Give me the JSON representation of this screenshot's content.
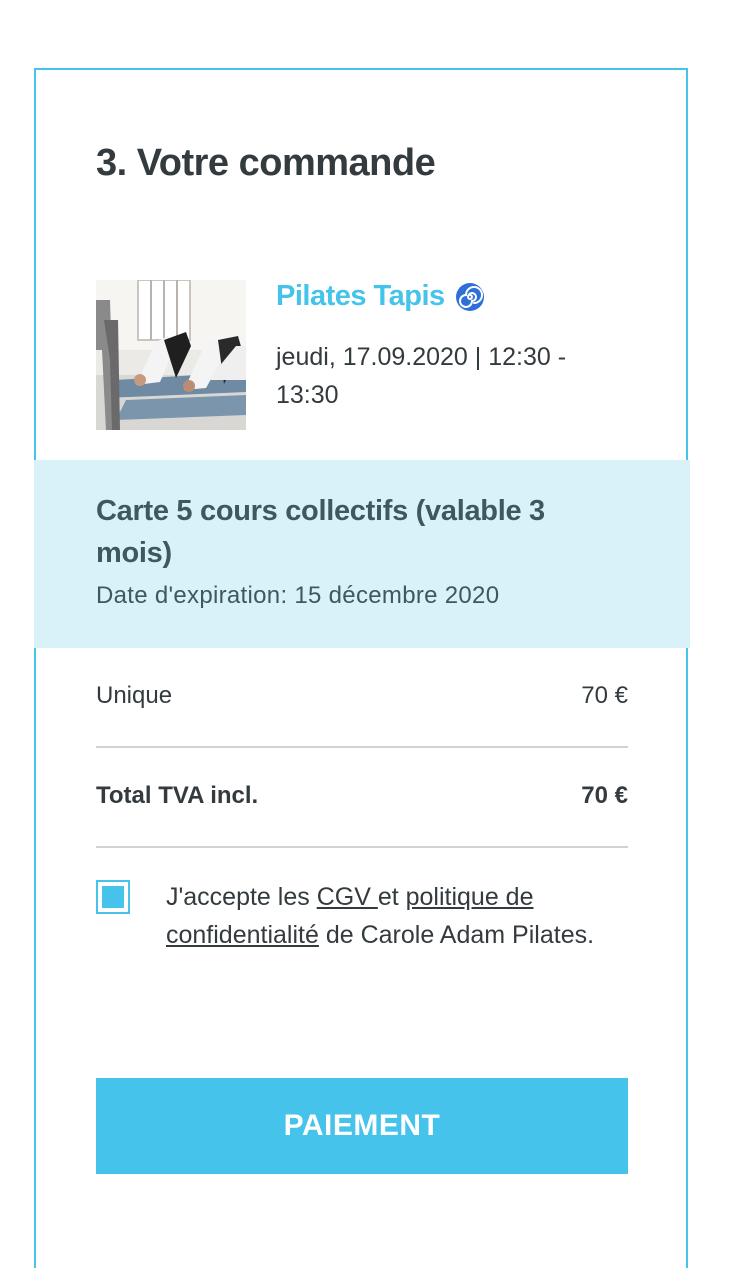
{
  "order": {
    "title": "3. Votre commande",
    "course": {
      "name": "Pilates Tapis",
      "icon": "spiral-icon",
      "date_line": "jeudi, 17.09.2020 | 12:30 - 13:30"
    },
    "plan": {
      "name": "Carte 5 cours collectifs (valable 3 mois)",
      "expiry": "Date d'expiration: 15 décembre 2020"
    },
    "lines": {
      "unique_label": "Unique",
      "unique_price": "70 €",
      "total_label": "Total TVA incl.",
      "total_price": "70 €"
    },
    "consent": {
      "checked": true,
      "prefix": "J'accepte les ",
      "cgv_link": "CGV ",
      "middle": "et ",
      "privacy_link": "politique de confidentialité",
      "suffix": " de Carole Adam Pilates."
    },
    "pay_button_label": "PAIEMENT"
  },
  "colors": {
    "accent": "#45c3ea",
    "plan_bg": "#d9f2f9",
    "text": "#333b3f",
    "plan_text": "#3d5860",
    "divider": "#d2d2d2"
  }
}
